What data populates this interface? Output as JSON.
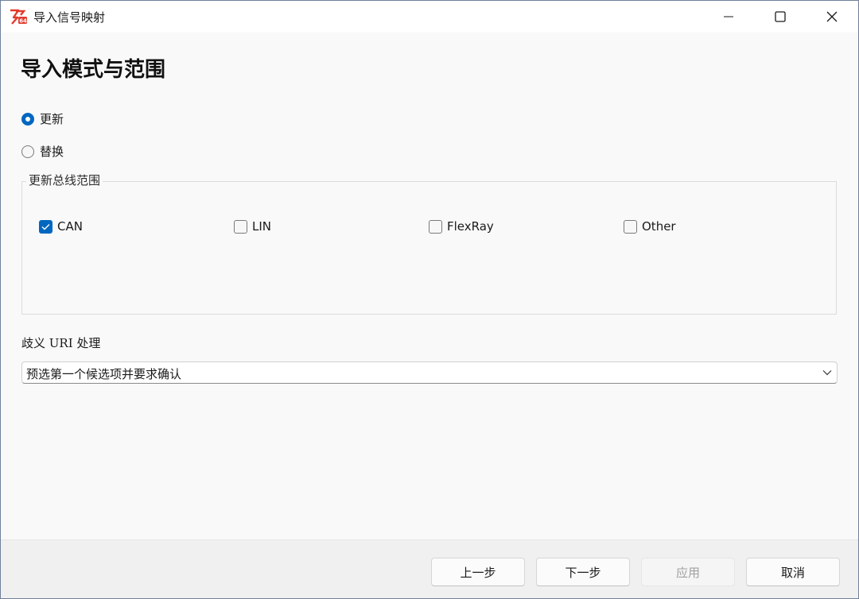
{
  "window": {
    "title": "导入信号映射",
    "controls": {
      "minimize": "minimize-icon",
      "maximize": "maximize-icon",
      "close": "close-icon"
    }
  },
  "page": {
    "heading": "导入模式与范围"
  },
  "mode": {
    "options": [
      {
        "label": "更新",
        "selected": true
      },
      {
        "label": "替换",
        "selected": false
      }
    ]
  },
  "bus_scope": {
    "title": "更新总线范围",
    "items": [
      {
        "label": "CAN",
        "checked": true
      },
      {
        "label": "LIN",
        "checked": false
      },
      {
        "label": "FlexRay",
        "checked": false
      },
      {
        "label": "Other",
        "checked": false
      }
    ]
  },
  "ambiguous_uri": {
    "label": "歧义 URI 处理",
    "selected": "预选第一个候选项并要求确认"
  },
  "footer": {
    "back": "上一步",
    "next": "下一步",
    "apply": "应用",
    "cancel": "取消"
  },
  "colors": {
    "accent": "#0067c0",
    "disabled_text": "#a0a0a0"
  }
}
